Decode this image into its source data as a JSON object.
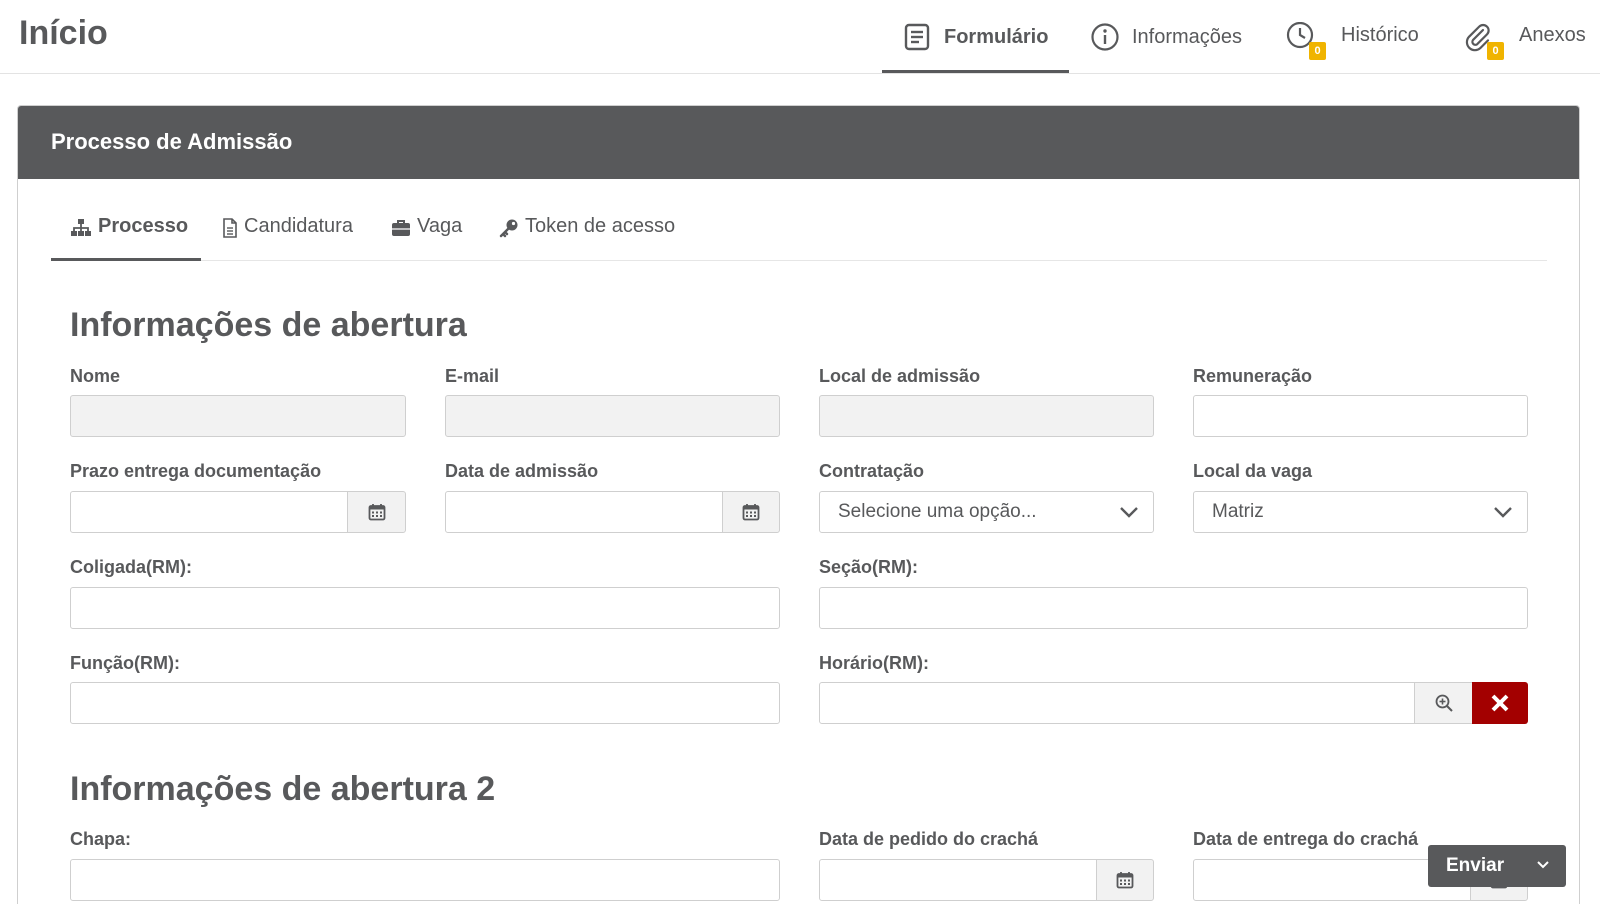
{
  "header": {
    "title": "Início",
    "tabs": [
      {
        "label": "Formulário",
        "icon": "form-icon",
        "active": true
      },
      {
        "label": "Informações",
        "icon": "info-icon"
      },
      {
        "label": "Histórico",
        "icon": "clock-icon",
        "badge": "0"
      },
      {
        "label": "Anexos",
        "icon": "paperclip-icon",
        "badge": "0"
      }
    ]
  },
  "panel": {
    "title": "Processo de Admissão",
    "tabs": [
      {
        "label": "Processo",
        "icon": "sitemap-icon",
        "active": true
      },
      {
        "label": "Candidatura",
        "icon": "document-icon"
      },
      {
        "label": "Vaga",
        "icon": "briefcase-icon"
      },
      {
        "label": "Token de acesso",
        "icon": "key-icon"
      }
    ]
  },
  "section1": {
    "title": "Informações de abertura",
    "fields": {
      "nome": {
        "label": "Nome",
        "value": ""
      },
      "email": {
        "label": "E-mail",
        "value": ""
      },
      "local_admissao": {
        "label": "Local de admissão",
        "value": ""
      },
      "remuneracao": {
        "label": "Remuneração",
        "value": ""
      },
      "prazo_documentacao": {
        "label": "Prazo entrega documentação",
        "value": ""
      },
      "data_admissao": {
        "label": "Data de admissão",
        "value": ""
      },
      "contratacao": {
        "label": "Contratação",
        "selected": "Selecione uma opção..."
      },
      "local_vaga": {
        "label": "Local da vaga",
        "selected": "Matriz"
      },
      "coligada": {
        "label": "Coligada(RM):",
        "value": ""
      },
      "secao": {
        "label": "Seção(RM):",
        "value": ""
      },
      "funcao": {
        "label": "Função(RM):",
        "value": ""
      },
      "horario": {
        "label": "Horário(RM):",
        "value": ""
      }
    }
  },
  "section2": {
    "title": "Informações de abertura 2",
    "fields": {
      "chapa": {
        "label": "Chapa:",
        "value": ""
      },
      "data_pedido_cracha": {
        "label": "Data de pedido do crachá",
        "value": ""
      },
      "data_entrega_cracha": {
        "label": "Data de entrega do crachá",
        "value": ""
      }
    }
  },
  "actions": {
    "send_label": "Enviar"
  },
  "colors": {
    "header_dark": "#58595b",
    "badge": "#f0b400",
    "danger": "#a30000"
  }
}
